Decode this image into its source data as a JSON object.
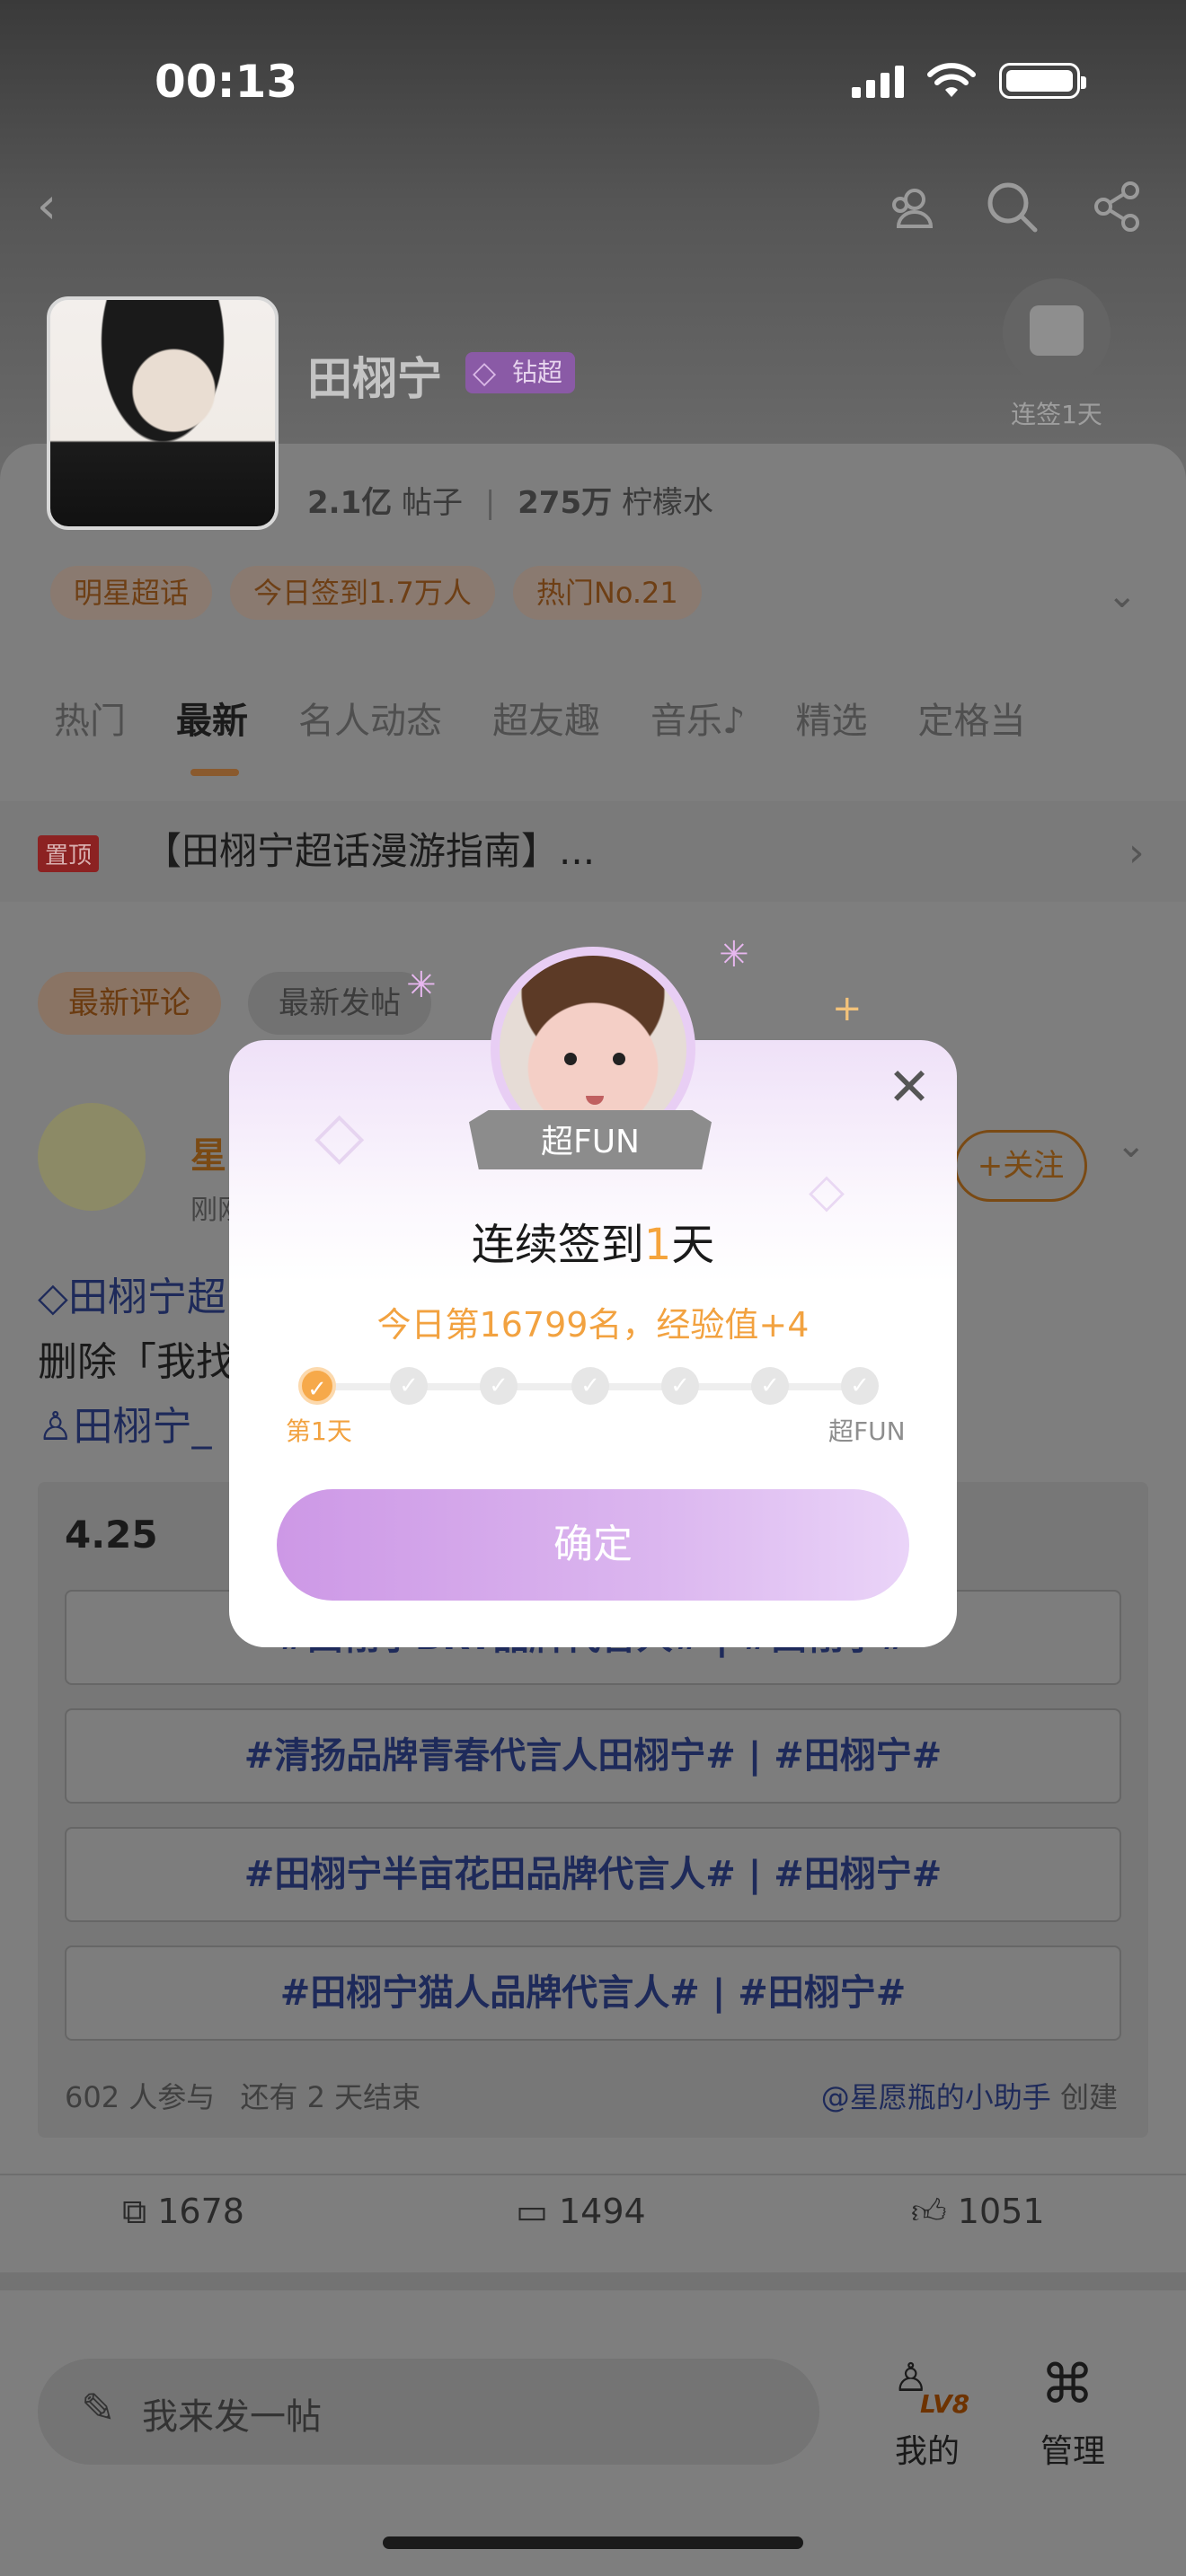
{
  "status_bar": {
    "time": "00:13"
  },
  "header": {
    "back_icon": "chevron-left-icon",
    "group_icon": "people-icon",
    "search_icon": "search-icon",
    "share_icon": "share-icon",
    "name": "田栩宁",
    "vip_label": "钻超",
    "checkin_label": "连签1天"
  },
  "stats": {
    "posts_value": "2.1亿",
    "posts_label": "帖子",
    "fans_value": "275万",
    "fans_label": "柠檬水"
  },
  "tags": [
    "明星超话",
    "今日签到1.7万人",
    "热门No.21"
  ],
  "tabs": [
    "热门",
    "最新",
    "名人动态",
    "超友趣",
    "音乐♪",
    "精选",
    "定格当"
  ],
  "pinned": {
    "badge": "置顶",
    "text": "【田栩宁超话漫游指南】..."
  },
  "filters": {
    "latest_comment": "最新评论",
    "latest_post": "最新发帖"
  },
  "post": {
    "author": "星",
    "time": "刚刚",
    "follow": "+关注",
    "line1": "田栩宁超",
    "line2": "删除「我找",
    "line3": "田栩宁_",
    "vote": {
      "date": "4.25",
      "options": [
        "#田栩宁BRT品牌代言人# | #田栩宁#",
        "#清扬品牌青春代言人田栩宁# | #田栩宁#",
        "#田栩宁半亩花田品牌代言人# | #田栩宁#",
        "#田栩宁猫人品牌代言人# | #田栩宁#"
      ],
      "participants": "602 人参与",
      "remaining": "还有 2 天结束",
      "creator": "@星愿瓶的小助手",
      "creator_suffix": "创建"
    },
    "actions": {
      "repost": "1678",
      "comment": "1494",
      "like": "1051"
    }
  },
  "bottom": {
    "compose": "我来发一帖",
    "mine": "我的",
    "level": "LV8",
    "manage": "管理"
  },
  "modal": {
    "ribbon": "超FUN",
    "title_prefix": "连续签到",
    "title_days": "1",
    "title_suffix": "天",
    "subtitle": "今日第16799名，经验值+4",
    "step_first": "第1天",
    "step_last": "超FUN",
    "confirm": "确定",
    "close_icon": "close-icon"
  }
}
